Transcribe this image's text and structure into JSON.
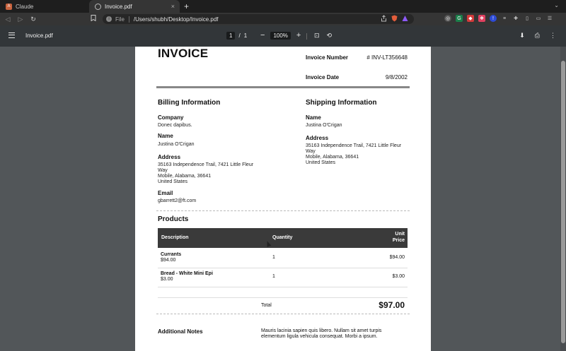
{
  "browser": {
    "tabs": [
      {
        "title": "Claude",
        "active": false
      },
      {
        "title": "Invoice.pdf",
        "active": true
      }
    ],
    "new_tab": "+",
    "tab_close": "×",
    "tabs_dropdown": "⌄",
    "address": {
      "scheme_label": "File",
      "url": "/Users/shubh/Desktop/Invoice.pdf"
    },
    "nav": {
      "back": "◁",
      "forward": "▷",
      "reload": "↻"
    },
    "bookmark": "🔖"
  },
  "pdf_toolbar": {
    "title": "Invoice.pdf",
    "current_page": "1",
    "page_sep": "/",
    "total_pages": "1",
    "zoom_out": "−",
    "zoom": "100%",
    "zoom_in": "+",
    "fit_icon": "⊡",
    "rotate_icon": "⟲",
    "download_icon": "⬇",
    "print_icon": "⎙",
    "more_icon": "⋮"
  },
  "invoice": {
    "title": "INVOICE",
    "number_label": "Invoice Number",
    "number_value": "# INV-LT356648",
    "date_label": "Invoice Date",
    "date_value": "9/8/2002",
    "billing": {
      "heading": "Billing Information",
      "company_label": "Company",
      "company": "Donec dapibus.",
      "name_label": "Name",
      "name": "Justina O'Crigan",
      "address_label": "Address",
      "address_l1": "35163 Independence Trail, 7421 Little Fleur",
      "address_l2": "Way",
      "address_l3": "Mobile, Alabama, 36641",
      "address_l4": "United States",
      "email_label": "Email",
      "email": "gbarrett2@ft.com"
    },
    "shipping": {
      "heading": "Shipping Information",
      "name_label": "Name",
      "name": "Justina O'Crigan",
      "address_label": "Address",
      "address_l1": "35163 Independence Trail, 7421 Little Fleur",
      "address_l2": "Way",
      "address_l3": "Mobile, Alabama, 36641",
      "address_l4": "United States"
    },
    "products": {
      "heading": "Products",
      "col_desc": "Description",
      "col_qty": "Quantity",
      "col_unit_l1": "Unit",
      "col_unit_l2": "Price",
      "rows": [
        {
          "name": "Currants",
          "price_sub": "$94.00",
          "qty": "1",
          "unit": "$94.00"
        },
        {
          "name": "Bread - White Mini Epi",
          "price_sub": "$3.00",
          "qty": "1",
          "unit": "$3.00"
        }
      ]
    },
    "total_label": "Total",
    "total_value": "$97.00",
    "notes_label": "Additional Notes",
    "notes_text": "Mauris lacinia sapien quis libero. Nullam sit amet turpis elementum ligula vehicula consequat. Morbi a ipsum."
  }
}
